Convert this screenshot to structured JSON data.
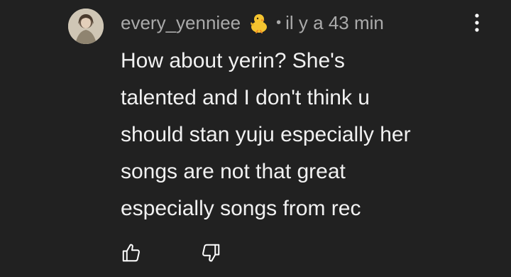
{
  "comment": {
    "author": "every_yenniee",
    "author_emoji_icon": "baby-chick-icon",
    "separator": "•",
    "timestamp": "il y a 43 min",
    "text_lines": [
      "How about yerin? She's",
      "talented and I don't think u",
      "should stan yuju especially her",
      "songs are not that great",
      "especially songs from rec"
    ],
    "actions": {
      "like_icon": "thumbs-up-icon",
      "dislike_icon": "thumbs-down-icon",
      "menu_icon": "more-vertical-icon"
    }
  },
  "colors": {
    "background": "#212121",
    "meta_text": "#aaaaaa",
    "body_text": "#f1f1f1"
  }
}
